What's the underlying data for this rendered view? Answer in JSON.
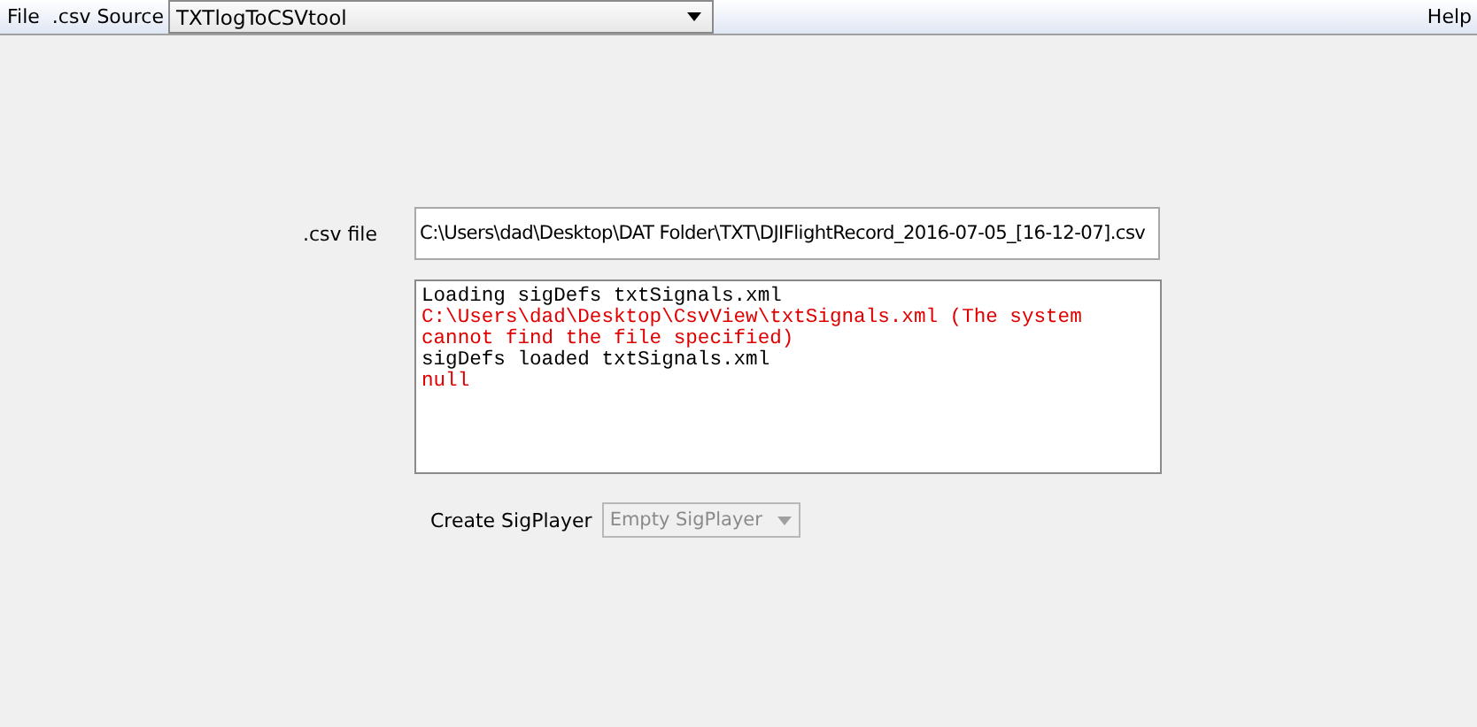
{
  "menu_bar": {
    "left_items": [
      "File"
    ],
    "source_label": ".csv Source",
    "source_combo": {
      "value": "TXTlogToCSVtool",
      "disabled": false
    },
    "right_items": [
      "Help"
    ]
  },
  "csv_file": {
    "label": ".csv file",
    "value": "C:\\Users\\dad\\Desktop\\DAT Folder\\TXT\\DJIFlightRecord_2016-07-05_[16-12-07].csv"
  },
  "log": [
    {
      "kind": "info",
      "text": "Loading sigDefs txtSignals.xml"
    },
    {
      "kind": "error",
      "text": "C:\\Users\\dad\\Desktop\\CsvView\\txtSignals.xml (The system cannot find the file specified)"
    },
    {
      "kind": "info",
      "text": "sigDefs loaded txtSignals.xml"
    },
    {
      "kind": "error",
      "text": "null"
    }
  ],
  "sig_player": {
    "label": "Create SigPlayer",
    "combo": {
      "value": "Empty SigPlayer",
      "disabled": true
    }
  }
}
